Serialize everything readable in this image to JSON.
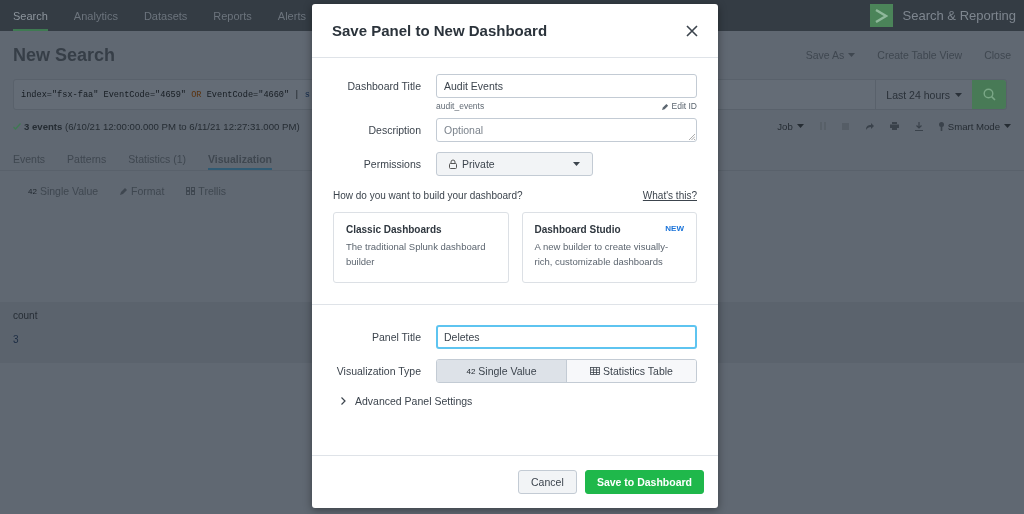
{
  "nav": {
    "items": [
      {
        "label": "Search",
        "selected": true
      },
      {
        "label": "Analytics",
        "selected": false
      },
      {
        "label": "Datasets",
        "selected": false
      },
      {
        "label": "Reports",
        "selected": false
      },
      {
        "label": "Alerts",
        "selected": false
      }
    ],
    "app_name": "Search & Reporting"
  },
  "page": {
    "title": "New Search",
    "actions": [
      {
        "label": "Save As",
        "dropdown": true
      },
      {
        "label": "Create Table View",
        "dropdown": false
      },
      {
        "label": "Close",
        "dropdown": false
      }
    ]
  },
  "search": {
    "query": [
      {
        "kind": "text",
        "text": "index=\"fsx-faa\" EventCode=\"4659\" "
      },
      {
        "kind": "keyword",
        "text": "OR"
      },
      {
        "kind": "text",
        "text": " EventCode=\"4660\" | "
      },
      {
        "kind": "command",
        "text": "s"
      }
    ],
    "time_range": "Last 24 hours"
  },
  "status": {
    "summary": "**3 events** (6/10/21 12:00:00.000 PM to 6/11/21 12:27:31.000 PM)",
    "job": "Job",
    "mode": "Smart Mode"
  },
  "tabs": [
    {
      "label": "Events",
      "selected": false
    },
    {
      "label": "Patterns",
      "selected": false
    },
    {
      "label": "Statistics (1)",
      "selected": false
    },
    {
      "label": "Visualization",
      "selected": true
    }
  ],
  "viz_toolbar": [
    {
      "kind": "single",
      "badge": "42",
      "label": "Single Value"
    },
    {
      "kind": "format",
      "label": "Format"
    },
    {
      "kind": "trellis",
      "label": "Trellis"
    }
  ],
  "table": {
    "columns": [
      "count"
    ],
    "rows": [
      [
        "3"
      ]
    ]
  },
  "dialog": {
    "title": "Save Panel to New Dashboard",
    "dashboard_title": {
      "label": "Dashboard Title",
      "value": "Audit Events",
      "id": "audit_events",
      "edit_link": "Edit ID"
    },
    "description": {
      "label": "Description",
      "placeholder": "Optional"
    },
    "permissions": {
      "label": "Permissions",
      "value": "Private"
    },
    "build_question": "How do you want to build your dashboard?",
    "help_link": "What's this?",
    "builders": [
      {
        "title": "Classic Dashboards",
        "description": "The traditional Splunk dashboard builder"
      },
      {
        "title": "Dashboard Studio",
        "badge": "NEW",
        "description": "A new builder to create visually-rich, customizable dashboards"
      }
    ],
    "panel_title": {
      "label": "Panel Title",
      "value": "Deletes",
      "focused": true
    },
    "visualization_type": {
      "label": "Visualization Type",
      "options": [
        {
          "kind": "single",
          "badge": "42",
          "label": "Single Value",
          "selected": true
        },
        {
          "kind": "table",
          "label": "Statistics Table",
          "selected": false
        }
      ]
    },
    "advanced": {
      "label": "Advanced Panel Settings",
      "expanded": false
    },
    "buttons": [
      {
        "kind": "secondary",
        "label": "Cancel"
      },
      {
        "kind": "primary",
        "label": "Save to Dashboard"
      }
    ]
  }
}
